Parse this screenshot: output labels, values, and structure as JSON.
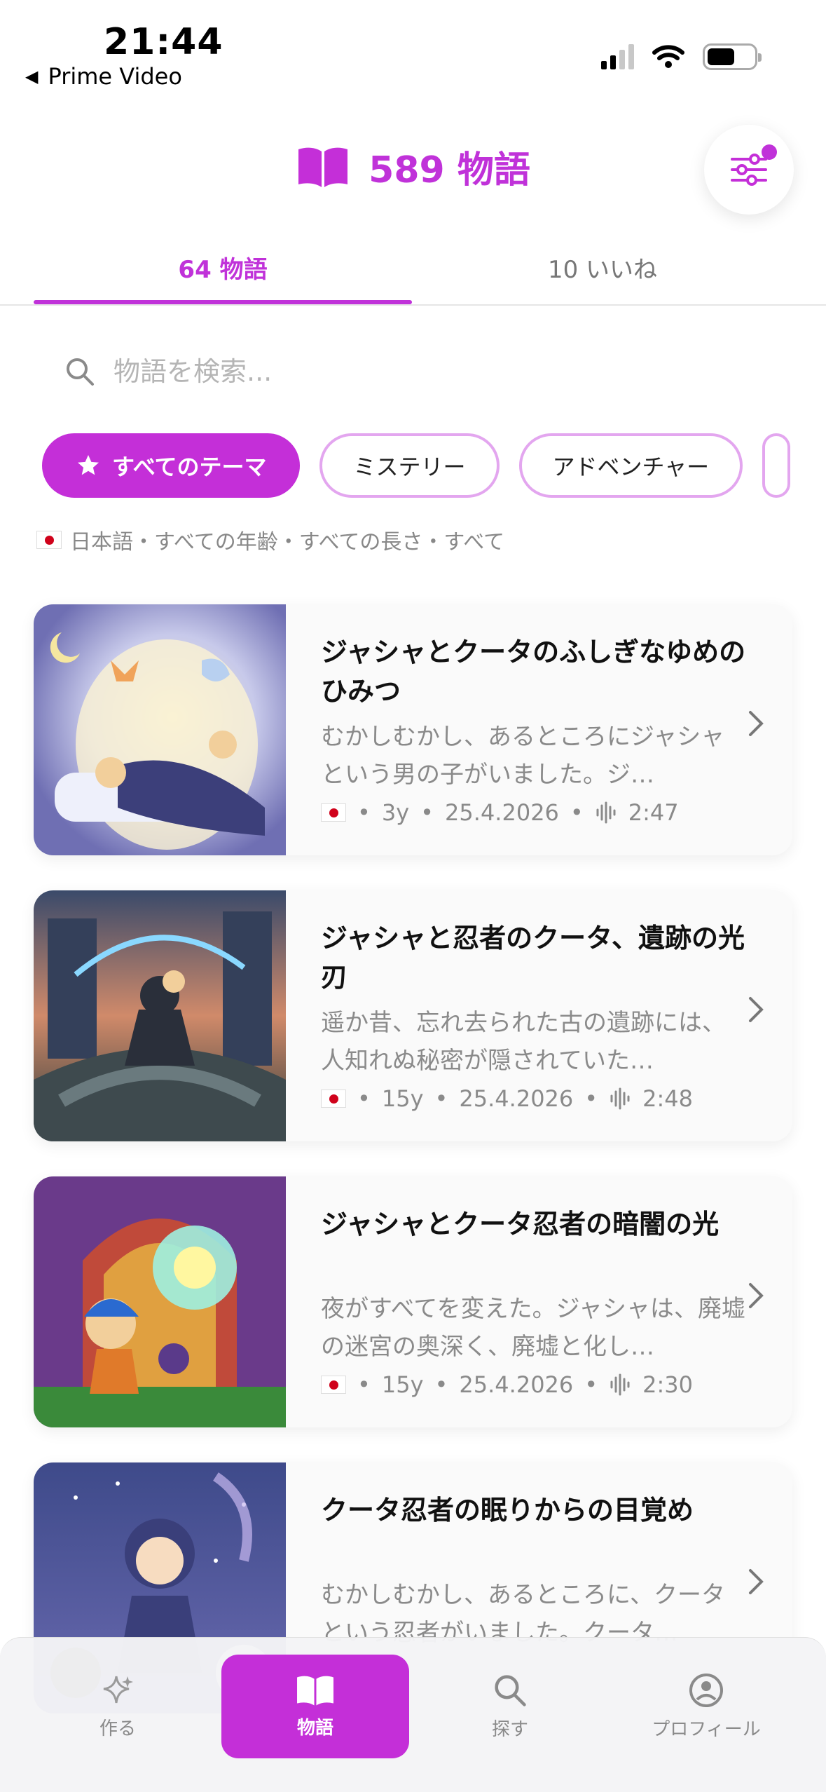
{
  "status_bar": {
    "time": "21:44",
    "back_app": "Prime Video"
  },
  "header": {
    "count": "589 物語"
  },
  "tabs": [
    {
      "label": "64 物語",
      "active": true
    },
    {
      "label": "10 いいね",
      "active": false
    }
  ],
  "search": {
    "placeholder": "物語を検索..."
  },
  "chips": [
    {
      "label": "すべてのテーマ",
      "active": true
    },
    {
      "label": "ミステリー",
      "active": false
    },
    {
      "label": "アドベンチャー",
      "active": false
    }
  ],
  "filters_summary": "日本語・すべての年齢・すべての長さ・すべて",
  "stories": [
    {
      "title": "ジャシャとクータのふしぎなゆめのひみつ",
      "excerpt": "むかしむかし、あるところにジャシャという男の子がいました。ジ…",
      "age": "3y",
      "date": "25.4.2026",
      "duration": "2:47"
    },
    {
      "title": "ジャシャと忍者のクータ、遺跡の光刃",
      "excerpt": "遥か昔、忘れ去られた古の遺跡には、人知れぬ秘密が隠されていた…",
      "age": "15y",
      "date": "25.4.2026",
      "duration": "2:48"
    },
    {
      "title": "ジャシャとクータ忍者の暗闇の光",
      "excerpt": "夜がすべてを変えた。ジャシャは、廃墟の迷宮の奥深く、廃墟と化し…",
      "age": "15y",
      "date": "25.4.2026",
      "duration": "2:30"
    },
    {
      "title": "クータ忍者の眠りからの目覚め",
      "excerpt": "むかしむかし、あるところに、クータという忍者がいました。クータ…",
      "age": "",
      "date": "",
      "duration": ""
    }
  ],
  "bottom_nav": [
    {
      "label": "作る",
      "icon": "sparkle-icon",
      "active": false
    },
    {
      "label": "物語",
      "icon": "book-icon",
      "active": true
    },
    {
      "label": "探す",
      "icon": "search-icon",
      "active": false
    },
    {
      "label": "プロフィール",
      "icon": "profile-icon",
      "active": false
    }
  ],
  "colors": {
    "accent": "#c42fd8",
    "chip_border": "#e3a6ef",
    "muted": "#8a8a8a"
  }
}
